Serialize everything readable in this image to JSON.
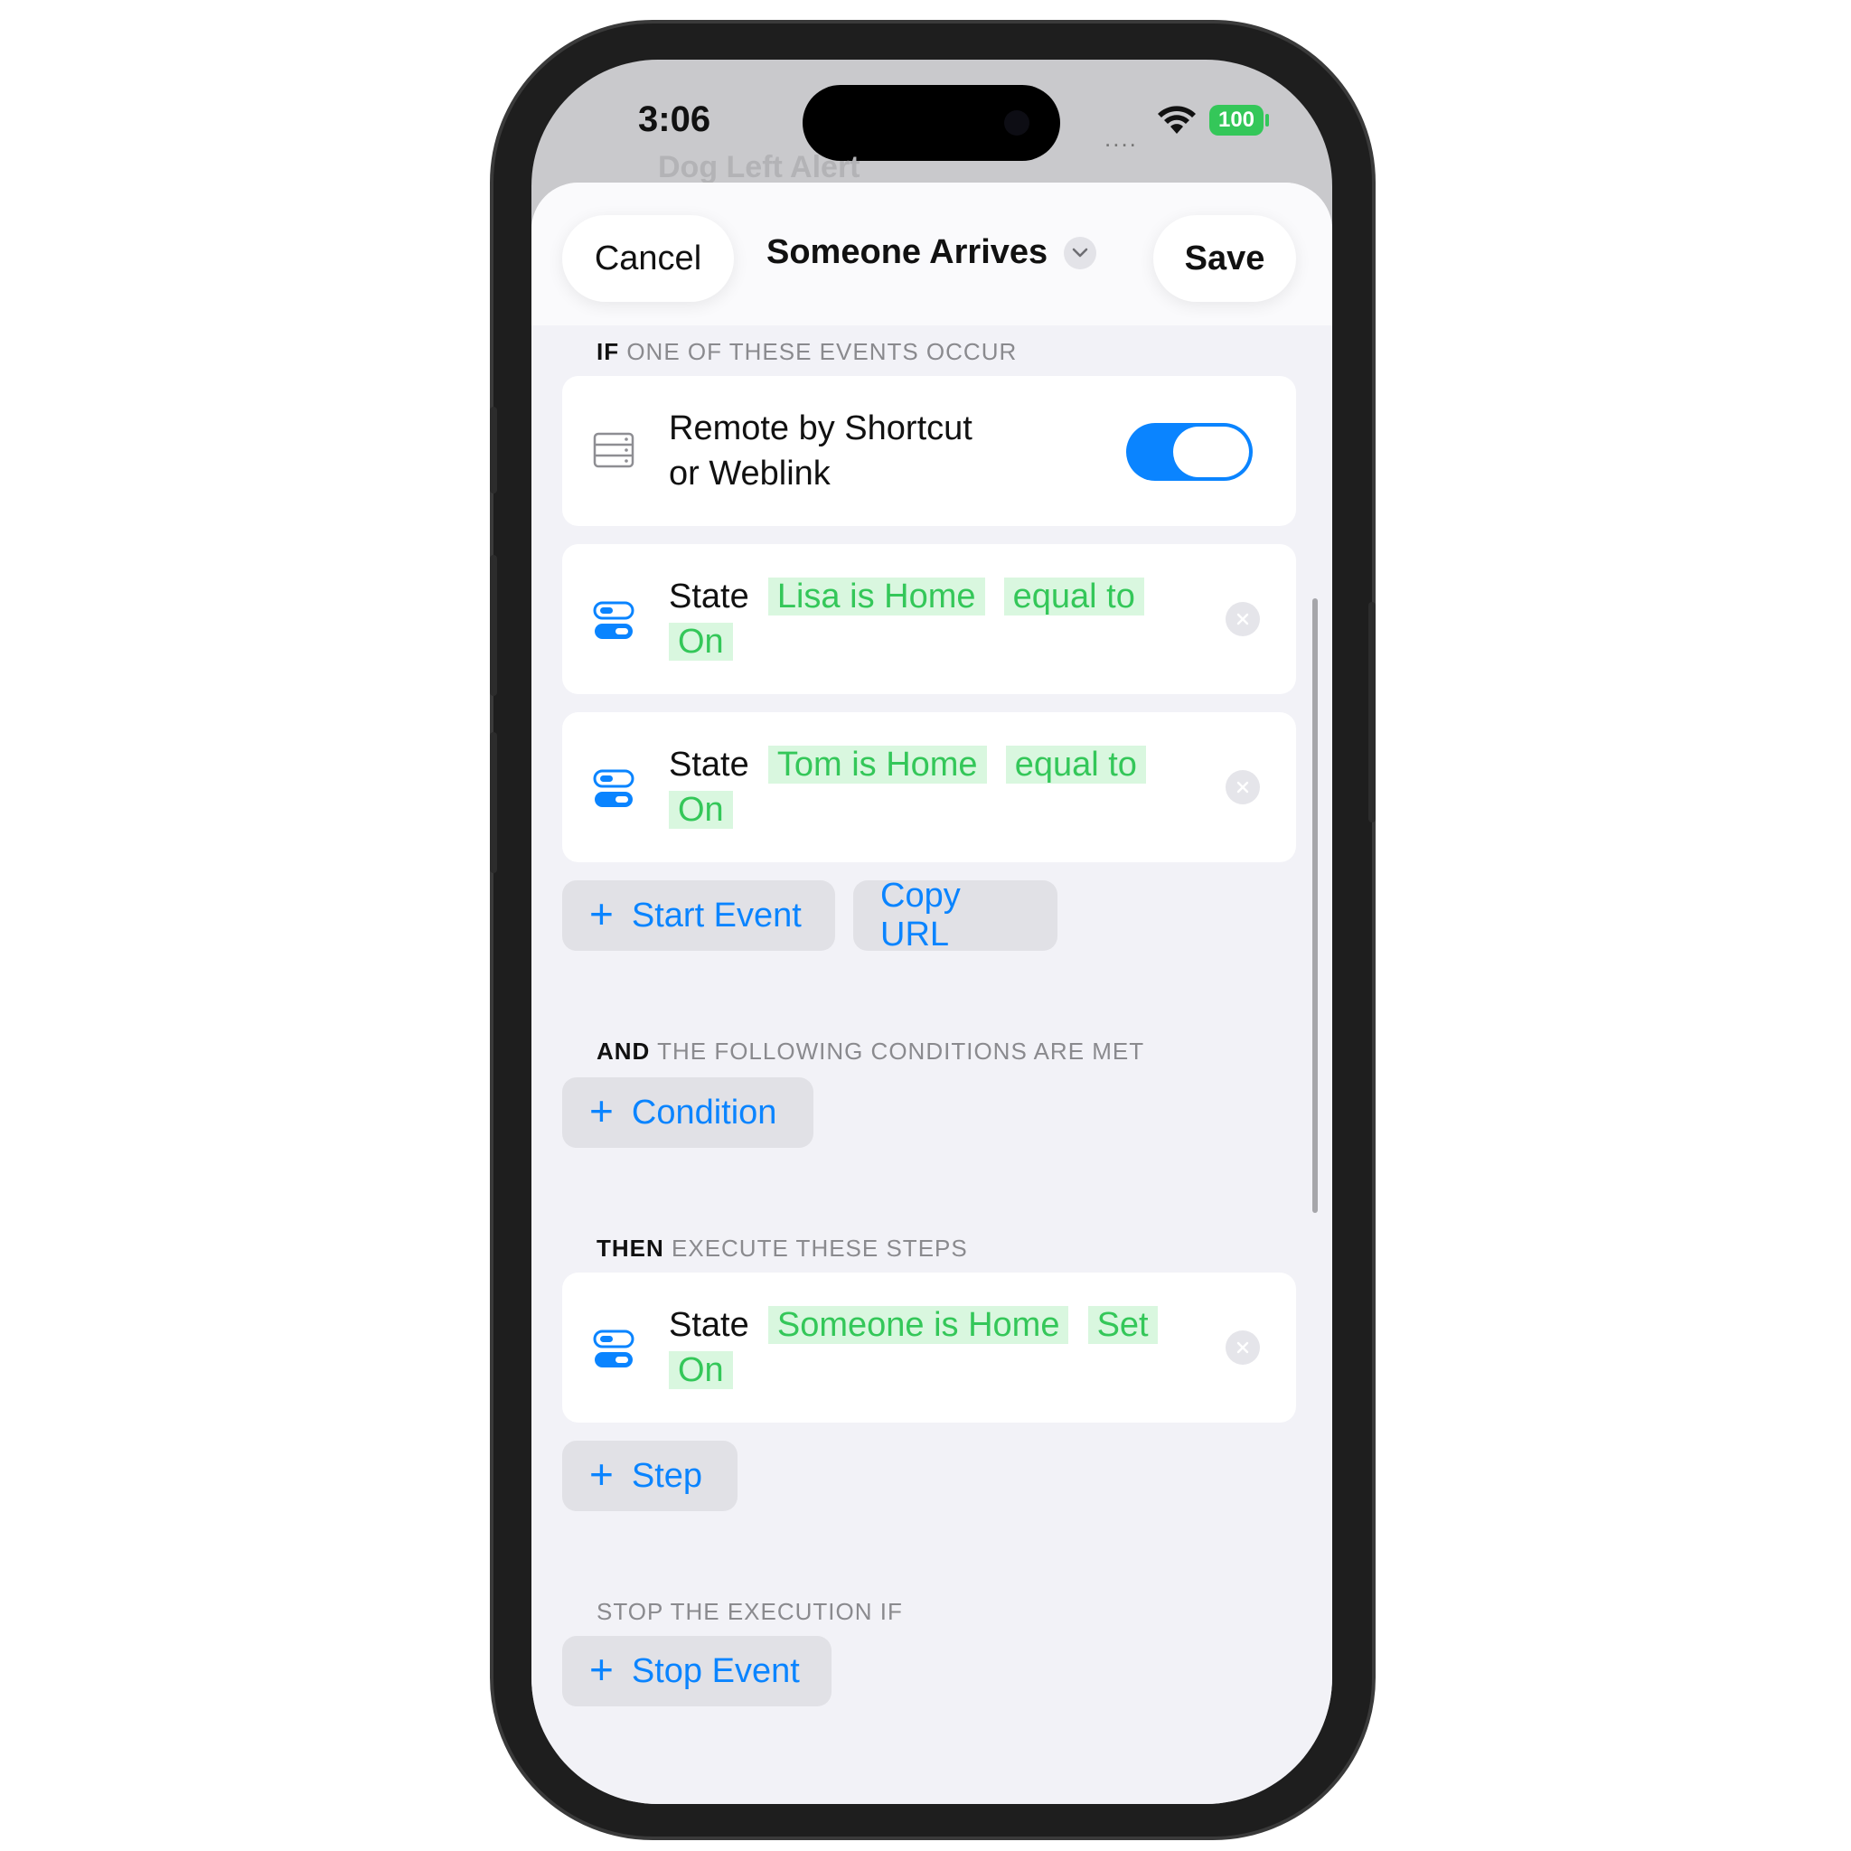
{
  "status_bar": {
    "time": "3:06",
    "signal": "....",
    "battery": "100"
  },
  "background": {
    "ghost_title": "Dog Left Alert"
  },
  "header": {
    "cancel_label": "Cancel",
    "title": "Someone Arrives",
    "save_label": "Save"
  },
  "sections": {
    "if": {
      "keyword": "IF",
      "rest": " ONE OF THESE EVENTS OCCUR"
    },
    "and": {
      "keyword": "AND",
      "rest": " THE FOLLOWING CONDITIONS ARE MET"
    },
    "then": {
      "keyword": "THEN",
      "rest": " EXECUTE THESE STEPS"
    },
    "stop": {
      "label": "STOP THE EXECUTION IF"
    }
  },
  "events": {
    "remote": {
      "line1": "Remote by Shortcut",
      "line2": "or Weblink",
      "enabled": true
    },
    "items": [
      {
        "kind": "State",
        "target": "Lisa is Home",
        "op": "equal to",
        "value": "On"
      },
      {
        "kind": "State",
        "target": "Tom is Home",
        "op": "equal to",
        "value": "On"
      }
    ],
    "start_event_label": "Start Event",
    "copy_url_label": "Copy URL"
  },
  "conditions": {
    "add_label": "Condition"
  },
  "steps": {
    "items": [
      {
        "kind": "State",
        "target": "Someone is Home",
        "op": "Set",
        "value": "On"
      }
    ],
    "add_label": "Step"
  },
  "stop": {
    "add_label": "Stop Event"
  },
  "colors": {
    "accent": "#0a84ff",
    "tag_bg": "#d9f7df",
    "tag_text": "#34c759",
    "sheet_bg": "#f2f2f7"
  }
}
